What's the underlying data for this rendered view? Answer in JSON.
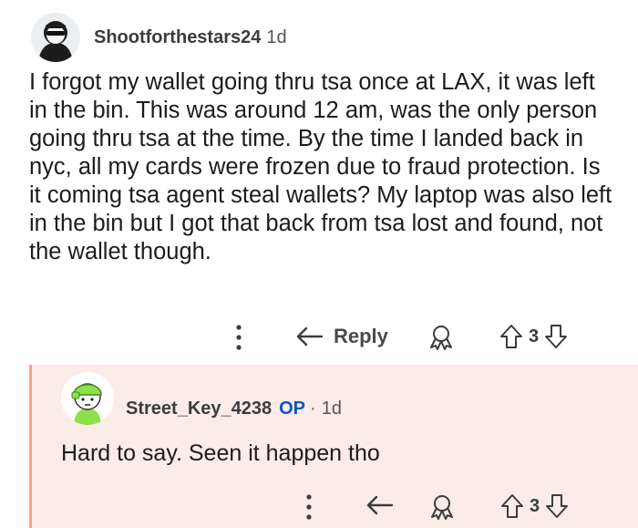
{
  "comment": {
    "author": "Shootforthestars24",
    "age": "1d",
    "body": "I forgot my wallet going thru tsa once at LAX, it was left in the bin. This was around 12 am, was the only person going thru tsa at the time. By the time I landed back in nyc, all my cards were frozen due to fraud protection. Is it coming tsa agent steal wallets? My laptop was also left in the bin but I got that back from tsa lost and found, not the wallet though.",
    "reply_label": "Reply",
    "votes": "3"
  },
  "reply": {
    "author": "Street_Key_4238",
    "op_badge": "OP",
    "separator": "·",
    "age": "1d",
    "body": "Hard to say. Seen it happen tho",
    "votes": "3"
  },
  "colors": {
    "reply_background": "#fcece8",
    "thread_line": "#f4a28c",
    "op_badge": "#0a56c2",
    "text": "#1c1c1c"
  },
  "icons": {
    "more": "more-vertical-icon",
    "reply": "reply-arrow-icon",
    "award": "award-icon",
    "upvote": "upvote-arrow-icon",
    "downvote": "downvote-arrow-icon"
  }
}
